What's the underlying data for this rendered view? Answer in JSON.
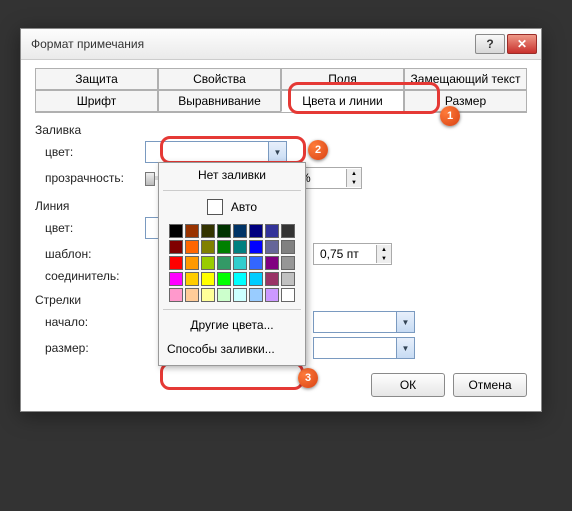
{
  "window": {
    "title": "Формат примечания",
    "help_icon": "?",
    "close_icon": "✕"
  },
  "tabs": {
    "row1": [
      "Защита",
      "Свойства",
      "Поля",
      "Замещающий текст"
    ],
    "row2": [
      "Шрифт",
      "Выравнивание",
      "Цвета и линии",
      "Размер"
    ],
    "active": "Цвета и линии"
  },
  "sections": {
    "fill": "Заливка",
    "line": "Линия",
    "arrows": "Стрелки"
  },
  "labels": {
    "color": "цвет:",
    "transparency": "прозрачность:",
    "line_color": "цвет:",
    "template": "шаблон:",
    "connector": "соединитель:",
    "begin": "начало:",
    "size": "размер:",
    "opacity_value": "0 %",
    "weight_value": "0,75 пт"
  },
  "popup": {
    "no_fill": "Нет заливки",
    "auto": "Авто",
    "more_colors": "Другие цвета...",
    "fill_effects": "Способы заливки...",
    "palette_rows": [
      [
        "#000000",
        "#993300",
        "#333300",
        "#003300",
        "#003366",
        "#000080",
        "#333399",
        "#333333"
      ],
      [
        "#800000",
        "#ff6600",
        "#808000",
        "#008000",
        "#008080",
        "#0000ff",
        "#666699",
        "#808080"
      ],
      [
        "#ff0000",
        "#ff9900",
        "#99cc00",
        "#339966",
        "#33cccc",
        "#3366ff",
        "#800080",
        "#969696"
      ],
      [
        "#ff00ff",
        "#ffcc00",
        "#ffff00",
        "#00ff00",
        "#00ffff",
        "#00ccff",
        "#993366",
        "#c0c0c0"
      ],
      [
        "#ff99cc",
        "#ffcc99",
        "#ffff99",
        "#ccffcc",
        "#ccffff",
        "#99ccff",
        "#cc99ff",
        "#ffffff"
      ]
    ]
  },
  "buttons": {
    "ok": "ОК",
    "cancel": "Отмена"
  },
  "callouts": {
    "b1": "1",
    "b2": "2",
    "b3": "3"
  }
}
